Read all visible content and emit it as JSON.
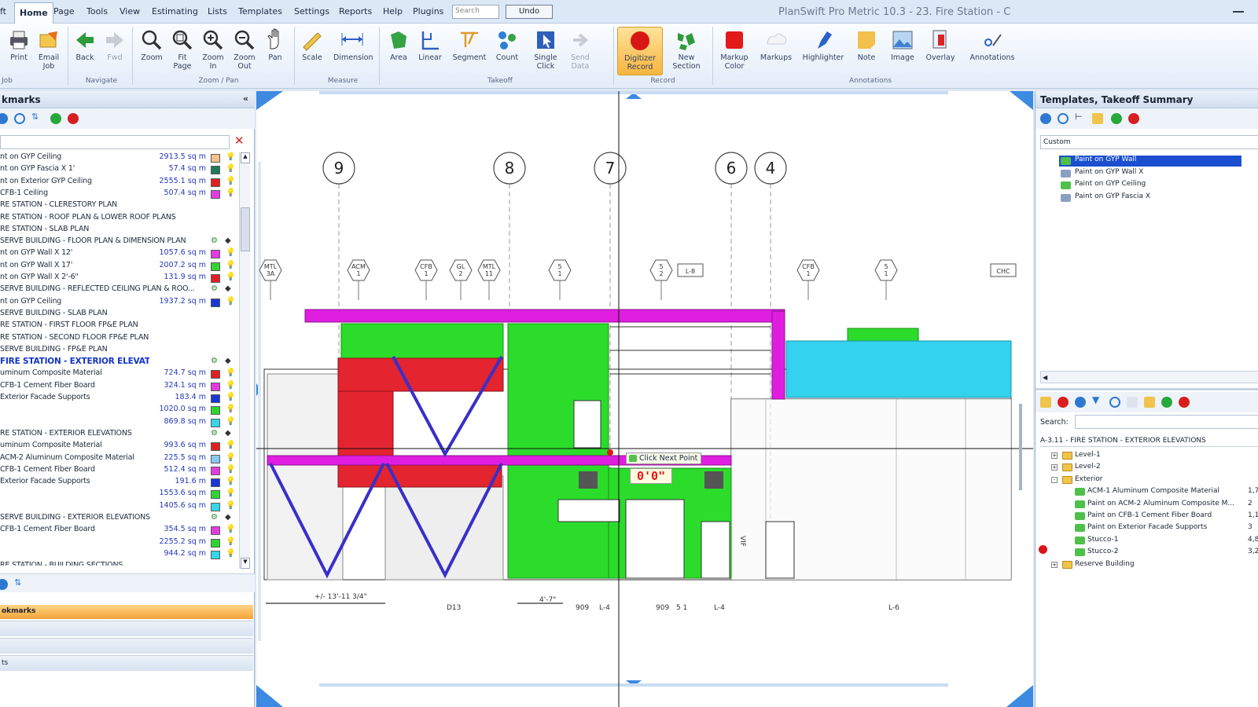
{
  "app": {
    "title": "PlanSwift Pro Metric 10.3 - 23. Fire Station - C",
    "menu": [
      "ft",
      "Home",
      "Page",
      "Tools",
      "View",
      "Estimating",
      "Lists",
      "Templates",
      "Settings",
      "Reports",
      "Help",
      "Plugins"
    ],
    "search_placeholder": "Search",
    "undo_label": "Undo"
  },
  "ribbon": {
    "buttons": [
      {
        "label": "Print",
        "icon": "printer-icon"
      },
      {
        "label": "Email\nJob",
        "icon": "email-icon"
      },
      {
        "label": "Back",
        "icon": "back-arrow-icon"
      },
      {
        "label": "Fwd",
        "icon": "forward-arrow-icon"
      },
      {
        "label": "Zoom",
        "icon": "zoom-icon"
      },
      {
        "label": "Fit\nPage",
        "icon": "fit-page-icon"
      },
      {
        "label": "Zoom\nIn",
        "icon": "zoom-in-icon"
      },
      {
        "label": "Zoom\nOut",
        "icon": "zoom-out-icon"
      },
      {
        "label": "Pan",
        "icon": "hand-icon"
      },
      {
        "label": "Scale",
        "icon": "scale-icon"
      },
      {
        "label": "Dimension",
        "icon": "dimension-icon"
      },
      {
        "label": "Area",
        "icon": "area-icon"
      },
      {
        "label": "Linear",
        "icon": "linear-icon"
      },
      {
        "label": "Segment",
        "icon": "segment-icon"
      },
      {
        "label": "Count",
        "icon": "count-icon"
      },
      {
        "label": "Single\nClick",
        "icon": "single-click-icon"
      },
      {
        "label": "Send\nData",
        "icon": "send-data-icon"
      },
      {
        "label": "Digitizer\nRecord",
        "icon": "record-icon"
      },
      {
        "label": "New\nSection",
        "icon": "new-section-icon"
      },
      {
        "label": "Markup\nColor",
        "icon": "markup-color-icon"
      },
      {
        "label": "Markups",
        "icon": "markups-icon"
      },
      {
        "label": "Highlighter",
        "icon": "highlighter-icon"
      },
      {
        "label": "Note",
        "icon": "note-icon"
      },
      {
        "label": "Image",
        "icon": "image-icon"
      },
      {
        "label": "Overlay",
        "icon": "overlay-icon"
      },
      {
        "label": "Annotations",
        "icon": "annotations-icon"
      }
    ],
    "groups": [
      "Job",
      "Navigate",
      "Zoom / Pan",
      "Measure",
      "Takeoff",
      "Record",
      "Annotations"
    ]
  },
  "left_panel": {
    "title": "kmarks",
    "collapse": "«",
    "items": [
      {
        "name": "nt on GYP Ceiling",
        "value": "2913.5 sq m",
        "color": "#f6c28a",
        "type": "item"
      },
      {
        "name": "nt on GYP Fascia X 1'",
        "value": "57.4 sq m",
        "color": "#1f7a5a",
        "type": "item"
      },
      {
        "name": "nt on Exterior GYP Ceiling",
        "value": "2555.1 sq m",
        "color": "#e02020",
        "type": "item"
      },
      {
        "name": "CFB-1 Ceiling",
        "value": "507.4 sq m",
        "color": "#e23ce0",
        "type": "item"
      },
      {
        "name": "RE STATION - CLERESTORY PLAN",
        "type": "section"
      },
      {
        "name": "RE STATION - ROOF PLAN & LOWER ROOF PLANS",
        "type": "section"
      },
      {
        "name": "RE STATION - SLAB PLAN",
        "type": "section"
      },
      {
        "name": "SERVE BUILDING - FLOOR PLAN & DIMENSION PLAN",
        "type": "section",
        "tags": true
      },
      {
        "name": "nt on GYP Wall X 12'",
        "value": "1057.6 sq m",
        "color": "#e23ce0",
        "type": "item"
      },
      {
        "name": "nt on GYP Wall X 17'",
        "value": "2007.2 sq m",
        "color": "#2fd52f",
        "type": "item"
      },
      {
        "name": "nt on GYP Wall X 2'-6\"",
        "value": "131.9 sq m",
        "color": "#e02020",
        "type": "item"
      },
      {
        "name": "SERVE BUILDING - REFLECTED CEILING PLAN & ROO...",
        "type": "section",
        "tags": true
      },
      {
        "name": "nt on GYP Ceiling",
        "value": "1937.2 sq m",
        "color": "#1a36d8",
        "type": "item"
      },
      {
        "name": "SERVE BUILDING - SLAB PLAN",
        "type": "section"
      },
      {
        "name": "RE STATION - FIRST FLOOR FP&E PLAN",
        "type": "section"
      },
      {
        "name": "RE STATION - SECOND FLOOR FP&E PLAN",
        "type": "section"
      },
      {
        "name": "SERVE BUILDING - FP&E PLAN",
        "type": "section"
      },
      {
        "name": "FIRE STATION - EXTERIOR ELEVATIONS",
        "type": "highlight",
        "tags": true
      },
      {
        "name": "uminum Composite Material",
        "value": "724.7 sq m",
        "color": "#e02020",
        "type": "item"
      },
      {
        "name": "CFB-1 Cement Fiber Board",
        "value": "324.1 sq m",
        "color": "#e23ce0",
        "type": "item"
      },
      {
        "name": "Exterior Facade Supports",
        "value": "183.4 m",
        "color": "#1a36d8",
        "type": "item"
      },
      {
        "name": "",
        "value": "1020.0 sq m",
        "color": "#2fd52f",
        "type": "item"
      },
      {
        "name": "",
        "value": "869.8 sq m",
        "color": "#38d4e8",
        "type": "item"
      },
      {
        "name": "RE STATION - EXTERIOR ELEVATIONS",
        "type": "section",
        "tags": true
      },
      {
        "name": "uminum Composite Material",
        "value": "993.6 sq m",
        "color": "#e02020",
        "type": "item"
      },
      {
        "name": "ACM-2 Aluminum Composite Material",
        "value": "225.5 sq m",
        "color": "#85c8f0",
        "type": "item"
      },
      {
        "name": "CFB-1 Cement Fiber Board",
        "value": "512.4 sq m",
        "color": "#e23ce0",
        "type": "item"
      },
      {
        "name": "Exterior Facade Supports",
        "value": "191.6 m",
        "color": "#1a36d8",
        "type": "item"
      },
      {
        "name": "",
        "value": "1553.6 sq m",
        "color": "#2fd52f",
        "type": "item"
      },
      {
        "name": "",
        "value": "1405.6 sq m",
        "color": "#38d4e8",
        "type": "item"
      },
      {
        "name": "SERVE BUILDING - EXTERIOR ELEVATIONS",
        "type": "section",
        "tags": true
      },
      {
        "name": "CFB-1 Cement Fiber Board",
        "value": "354.5 sq m",
        "color": "#e23ce0",
        "type": "item"
      },
      {
        "name": "",
        "value": "2255.2 sq m",
        "color": "#2fd52f",
        "type": "item"
      },
      {
        "name": "",
        "value": "944.2 sq m",
        "color": "#38d4e8",
        "type": "item"
      },
      {
        "name": "RE STATION - BUILDING SECTIONS",
        "type": "section"
      }
    ],
    "bottom_tabs": [
      "okmarks",
      "",
      "",
      " ts"
    ]
  },
  "canvas": {
    "tooltip": "Click Next Point",
    "length_readout": "0'0\"",
    "grid_bubbles": [
      "9",
      "8",
      "7",
      "6",
      "4"
    ],
    "tags": [
      "MTL\n3A",
      "ACM\n1",
      "CFB\n1",
      "GL\n2",
      "MTL\n11",
      "5\n1",
      "5\n2",
      "L-8",
      "CFB\n1",
      "5\n1",
      "CHC"
    ],
    "dims": [
      "+/- 13'-11 3/4\"",
      "D13",
      "4'-7\"",
      "909",
      "L-4",
      "909",
      "5\n1",
      "L-4",
      "L-6",
      "VIF"
    ]
  },
  "right_panel": {
    "title": "Templates, Takeoff Summary",
    "combo": "Custom",
    "templates": [
      {
        "label": "Paint on GYP Wall",
        "icon_color": "#4fc04a",
        "selected": true
      },
      {
        "label": "Paint on GYP Wall X",
        "icon_color": "#8aa0c0",
        "selected": false
      },
      {
        "label": "Paint on GYP Ceiling",
        "icon_color": "#4fc04a",
        "selected": false
      },
      {
        "label": "Paint on GYP Fascia X",
        "icon_color": "#8aa0c0",
        "selected": false
      }
    ],
    "search_label": "Search:",
    "summary_title": "A-3.11 - FIRE STATION - EXTERIOR ELEVATIONS",
    "tree": [
      {
        "label": "Level-1",
        "kind": "folder",
        "depth": 1,
        "exp": "+"
      },
      {
        "label": "Level-2",
        "kind": "folder",
        "depth": 1,
        "exp": "+"
      },
      {
        "label": "Exterior",
        "kind": "folder",
        "depth": 1,
        "exp": "-"
      },
      {
        "label": "ACM-1 Aluminum Composite Material",
        "kind": "item",
        "depth": 2,
        "value": "1,7"
      },
      {
        "label": "Paint on ACM-2 Aluminum Composite M...",
        "kind": "item",
        "depth": 2,
        "value": "2"
      },
      {
        "label": "Paint on CFB-1 Cement Fiber Board",
        "kind": "item",
        "depth": 2,
        "value": "1,1"
      },
      {
        "label": "Paint on Exterior Facade Supports",
        "kind": "item",
        "depth": 2,
        "value": "3"
      },
      {
        "label": "Stucco-1",
        "kind": "item",
        "depth": 2,
        "value": "4,8"
      },
      {
        "label": "Stucco-2",
        "kind": "item",
        "depth": 2,
        "value": "3,2"
      },
      {
        "label": "Reserve Building",
        "kind": "folder",
        "depth": 1,
        "exp": "+"
      }
    ]
  },
  "colors": {
    "magenta": "#e01ee0",
    "green": "#2bdc2b",
    "red": "#e4242f",
    "cyan": "#33d2ee",
    "blue": "#3a2fc8",
    "accent": "#1b4fcf"
  }
}
